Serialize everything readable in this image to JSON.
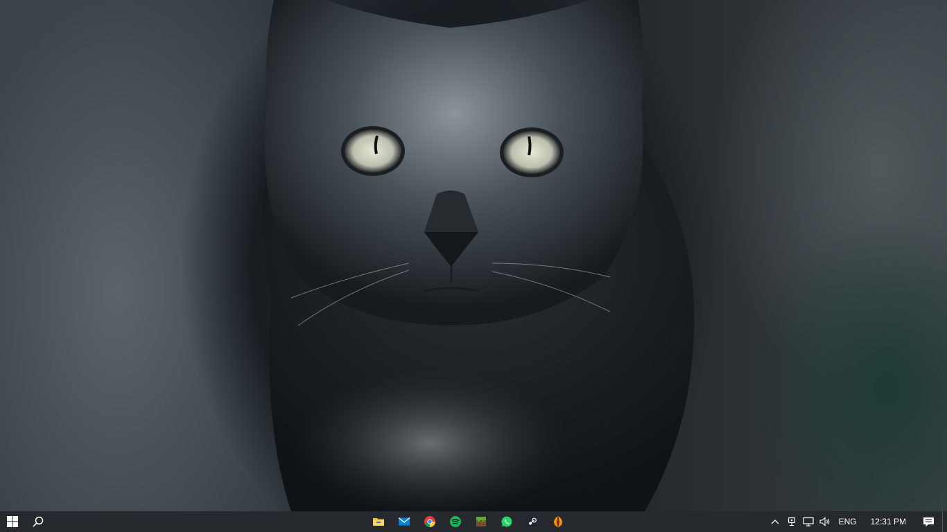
{
  "desktop": {
    "wallpaper": "cat-photo"
  },
  "taskbar": {
    "start": {
      "icon": "windows-logo-icon"
    },
    "search": {
      "icon": "search-icon"
    },
    "apps": [
      {
        "name": "file-explorer",
        "icon": "folder-icon"
      },
      {
        "name": "mail",
        "icon": "mail-icon"
      },
      {
        "name": "chrome",
        "icon": "chrome-icon"
      },
      {
        "name": "spotify",
        "icon": "spotify-icon"
      },
      {
        "name": "minecraft",
        "icon": "minecraft-icon"
      },
      {
        "name": "whatsapp",
        "icon": "whatsapp-icon"
      },
      {
        "name": "steam",
        "icon": "steam-icon"
      },
      {
        "name": "fl-studio",
        "icon": "fl-studio-icon"
      }
    ],
    "tray": {
      "language": "ENG",
      "time": "12:31 PM"
    },
    "colors": {
      "taskbar_bg": "#161a1e",
      "chrome_red": "#db4437",
      "spotify_green": "#1db954",
      "whatsapp_green": "#25d366",
      "folder_yellow": "#f2c14e",
      "mail_blue": "#0a84d8"
    }
  }
}
